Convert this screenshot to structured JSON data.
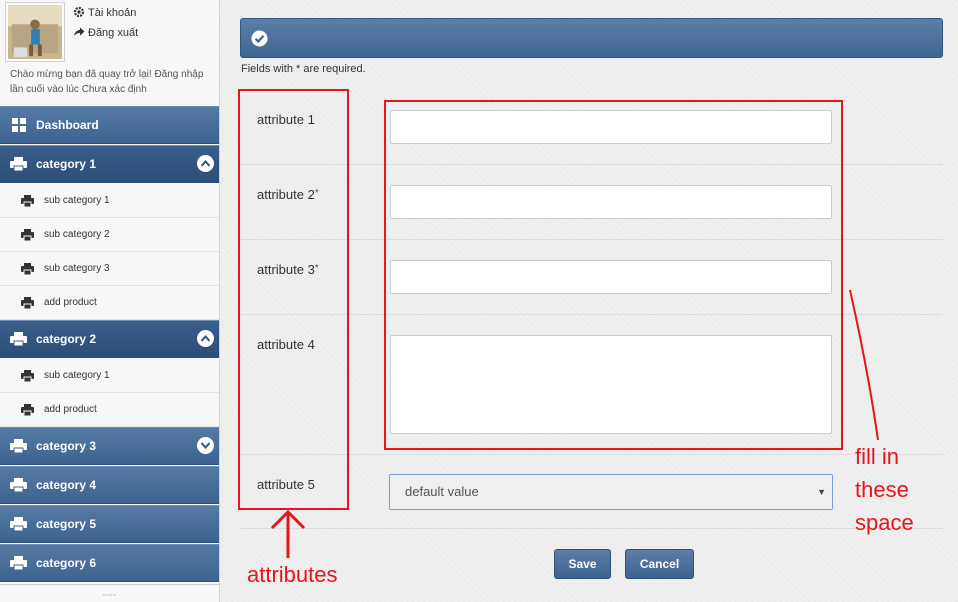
{
  "user": {
    "account_label": "Tài khoản",
    "logout_label": "Đăng xuất",
    "welcome_text": "Chào mừng bạn đã quay trở lại! Đăng nhập lần cuối vào lúc Chưa xác định"
  },
  "sidebar": {
    "dashboard": "Dashboard",
    "categories": [
      {
        "label": "category 1",
        "state": "expanded",
        "subs": [
          "sub category 1",
          "sub category 2",
          "sub category 3",
          "add product"
        ]
      },
      {
        "label": "category 2",
        "state": "expanded",
        "subs": [
          "sub category 1",
          "add product"
        ]
      },
      {
        "label": "category 3",
        "state": "collapsed"
      },
      {
        "label": "category 4"
      },
      {
        "label": "category 5"
      },
      {
        "label": "category 6"
      }
    ]
  },
  "form": {
    "required_note": "Fields with * are required.",
    "fields": [
      {
        "label": "attribute 1",
        "required": "",
        "value": ""
      },
      {
        "label": "attribute 2",
        "required": "*",
        "value": ""
      },
      {
        "label": "attribute 3",
        "required": "*",
        "value": ""
      },
      {
        "label": "attribute 4",
        "required": "",
        "value": ""
      },
      {
        "label": "attribute 5",
        "required": "",
        "selected": "default value"
      }
    ],
    "save_label": "Save",
    "cancel_label": "Cancel"
  },
  "annotations": {
    "left_label": "attributes",
    "right_label_lines": [
      "fill in",
      "these",
      "space"
    ],
    "color": "#e8141c"
  },
  "colors": {
    "accent": "#3e6592",
    "sidebar_bg": "#f7f7f7"
  }
}
